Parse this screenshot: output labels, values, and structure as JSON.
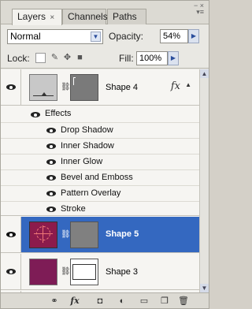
{
  "tabs": [
    {
      "label": "Layers",
      "close": "×"
    },
    {
      "label": "Channels"
    },
    {
      "label": "Paths"
    }
  ],
  "blend": {
    "mode": "Normal",
    "opacity_label": "Opacity:",
    "opacity_value": "54%"
  },
  "lock": {
    "label": "Lock:",
    "fill_label": "Fill:",
    "fill_value": "100%"
  },
  "layers": [
    {
      "name": "Shape 4",
      "thumb_color": "#c8c8c8",
      "has_fx": true,
      "fx_label": "fx"
    },
    {
      "name": "Shape 5",
      "thumb_color": "#8c1b4c",
      "selected": true
    },
    {
      "name": "Shape 3",
      "thumb_color": "#7e1c56"
    }
  ],
  "effects": {
    "header": "Effects",
    "items": [
      "Drop Shadow",
      "Inner Shadow",
      "Inner Glow",
      "Bevel and Emboss",
      "Pattern Overlay",
      "Stroke"
    ]
  },
  "footer_icons": [
    "link-icon",
    "fx-icon",
    "mask-icon",
    "adjustment-icon",
    "folder-icon",
    "new-layer-icon",
    "trash-icon"
  ],
  "footer_fx_label": "fx",
  "colors": {
    "selection": "#3468c0",
    "panel": "#e9e8e3"
  }
}
